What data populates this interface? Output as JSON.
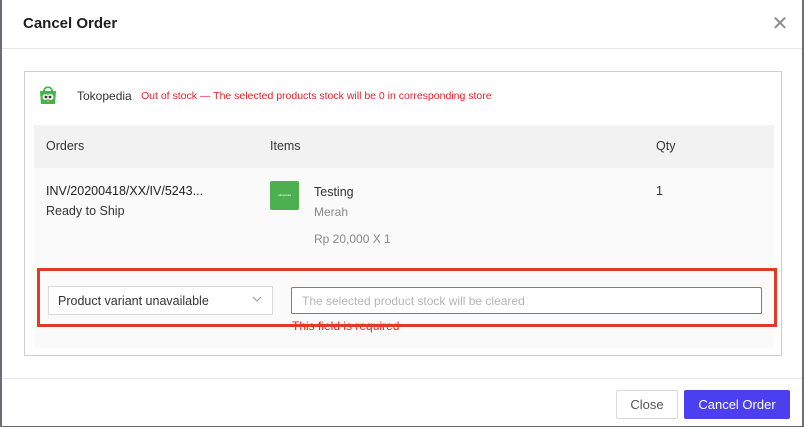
{
  "dialog": {
    "title": "Cancel Order",
    "close_icon": "close-icon"
  },
  "store": {
    "name": "Tokopedia",
    "logo_icon": "tokopedia-logo-icon",
    "warning": "Out of stock — The selected products stock will be 0 in corresponding store"
  },
  "table": {
    "columns": [
      "Orders",
      "Items",
      "Qty"
    ],
    "rows": [
      {
        "order_no": "INV/20200418/XX/IV/5243...",
        "status": "Ready to Ship",
        "thumbnail_text": "tokopedia",
        "item_name": "Testing",
        "variant": "Merah",
        "price": "Rp 20,000 X 1",
        "qty": "1"
      }
    ]
  },
  "reason": {
    "selected": "Product variant unavailable",
    "chevron_icon": "chevron-down-icon",
    "note_placeholder": "The selected product stock will be cleared",
    "note_value": "",
    "error": "This field is required"
  },
  "footer": {
    "close_label": "Close",
    "cancel_label": "Cancel Order"
  },
  "colors": {
    "primary": "#4c3ff0",
    "error": "#e0242b",
    "highlight": "#e03a2b"
  }
}
